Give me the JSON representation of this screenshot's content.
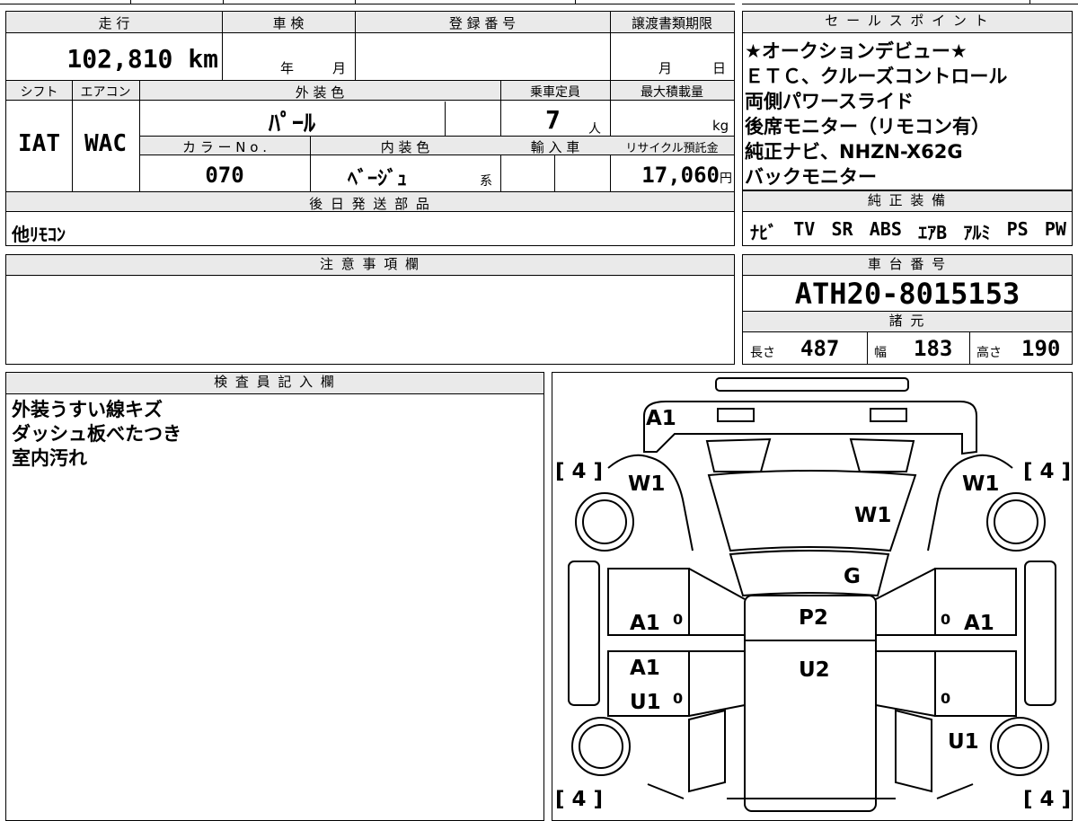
{
  "top_info": {
    "mileage_header": "走 行",
    "mileage": "102,810",
    "mileage_unit": "km",
    "inspection_header": "車 検",
    "inspection_year_unit": "年",
    "inspection_month_unit": "月",
    "registration_header": "登 録 番 号",
    "transfer_header": "譲渡書類期限",
    "transfer_month_unit": "月",
    "transfer_day_unit": "日",
    "shift_header": "シフト",
    "shift": "IAT",
    "ac_header": "エアコン",
    "ac": "WAC",
    "exterior_color_header": "外 装 色",
    "exterior_color": "ﾊﾟｰﾙ",
    "capacity_header": "乗車定員",
    "capacity": "7",
    "capacity_unit": "人",
    "max_load_header": "最大積載量",
    "max_load_unit": "kg",
    "color_no_header": "カ ラ ー N o .",
    "color_no": "070",
    "interior_color_header": "内 装 色",
    "interior_color": "ﾍﾞｰｼﾞｭ",
    "interior_color_suffix": "系",
    "import_header": "輸 入 車",
    "recycle_header": "リサイクル預託金",
    "recycle_fee": "17,060",
    "recycle_unit": "円",
    "later_parts_header": "後 日 発 送 部 品",
    "later_parts": "他ﾘﾓｺﾝ"
  },
  "sales_points": {
    "header": "セ ー ル ス ポ イ ン ト",
    "lines": [
      "★オークションデビュー★",
      "ＥＴＣ、クルーズコントロール",
      "両側パワースライド",
      "後席モニター（リモコン有）",
      "純正ナビ、NHZN-X62G",
      "バックモニター"
    ]
  },
  "equipment": {
    "header": "純 正 装 備",
    "items": [
      "ﾅﾋﾞ",
      "TV",
      "SR",
      "ABS",
      "ｴｱB",
      "ｱﾙﾐ",
      "PS",
      "PW"
    ]
  },
  "notes": {
    "header": "注 意 事 項 欄"
  },
  "chassis": {
    "header": "車 台 番 号",
    "number": "ATH20-8015153",
    "specs_header": "諸 元",
    "length_label": "長さ",
    "length": "487",
    "width_label": "幅",
    "width": "183",
    "height_label": "高さ",
    "height": "190"
  },
  "inspector": {
    "header": "検 査 員 記 入 欄",
    "remarks": [
      "外装うすい線キズ",
      "ダッシュ板べたつき",
      "室内汚れ"
    ]
  },
  "diagram": {
    "tire_front_left": "[ 4 ]",
    "tire_front_right": "[ 4 ]",
    "tire_rear_left": "[ 4 ]",
    "tire_rear_right": "[ 4 ]",
    "grade_front_bumper": "A1",
    "grade_front_left_fender": "W1",
    "grade_front_right_fender": "W1",
    "grade_hood": "W1",
    "grade_windshield": "G",
    "grade_roof_front": "P2",
    "grade_roof_rear": "U2",
    "grade_left_front_door": "A1",
    "grade_right_front_door": "A1",
    "grade_left_slide_door_1": "A1",
    "grade_left_slide_door_2": "U1",
    "grade_right_rear_quarter": "U1",
    "door_mark_1": "0",
    "door_mark_2": "0",
    "door_mark_3": "0",
    "door_mark_4": "0"
  }
}
